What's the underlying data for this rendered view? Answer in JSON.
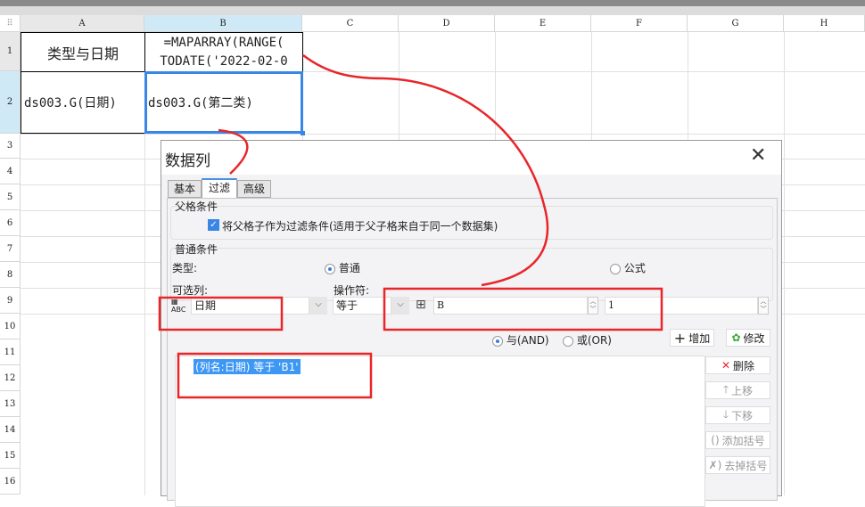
{
  "columns": [
    "A",
    "B",
    "C",
    "D",
    "E",
    "F",
    "G",
    "H"
  ],
  "rows": [
    "1",
    "2",
    "3",
    "4",
    "5",
    "6",
    "7",
    "8",
    "9",
    "10",
    "11",
    "12",
    "13",
    "14",
    "15",
    "16"
  ],
  "cells": {
    "A1": "类型与日期",
    "B1_line1": "=MAPARRAY(RANGE(",
    "B1_line2": "TODATE('2022-02-0",
    "A2": "ds003.G(日期)",
    "B2": "ds003.G(第二类)"
  },
  "dialog": {
    "title": "数据列",
    "tabs": [
      "基本",
      "过滤",
      "高级"
    ],
    "parent_group": {
      "title": "父格条件",
      "checkbox_label": "将父格子作为过滤条件(适用于父子格来自于同一个数据集)",
      "checked": true
    },
    "normal_group": {
      "title": "普通条件",
      "type_label": "类型:",
      "type_options": [
        "普通",
        "公式"
      ],
      "selected_type": "普通",
      "column_label": "可选列:",
      "column_value": "日期",
      "operator_label": "操作符:",
      "operator_value": "等于",
      "cell_col": "B",
      "cell_row": "1"
    },
    "logic": {
      "and_label": "与(AND)",
      "or_label": "或(OR)",
      "selected": "AND"
    },
    "buttons": {
      "add": "增加",
      "modify": "修改",
      "delete": "删除",
      "up": "上移",
      "down": "下移",
      "add_paren": "添加括号",
      "remove_paren": "去掉括号"
    },
    "conditions": [
      "(列名:日期) 等于 'B1'"
    ]
  },
  "colors": {
    "annotation": "#e8262a",
    "selection": "#3a86e6"
  }
}
